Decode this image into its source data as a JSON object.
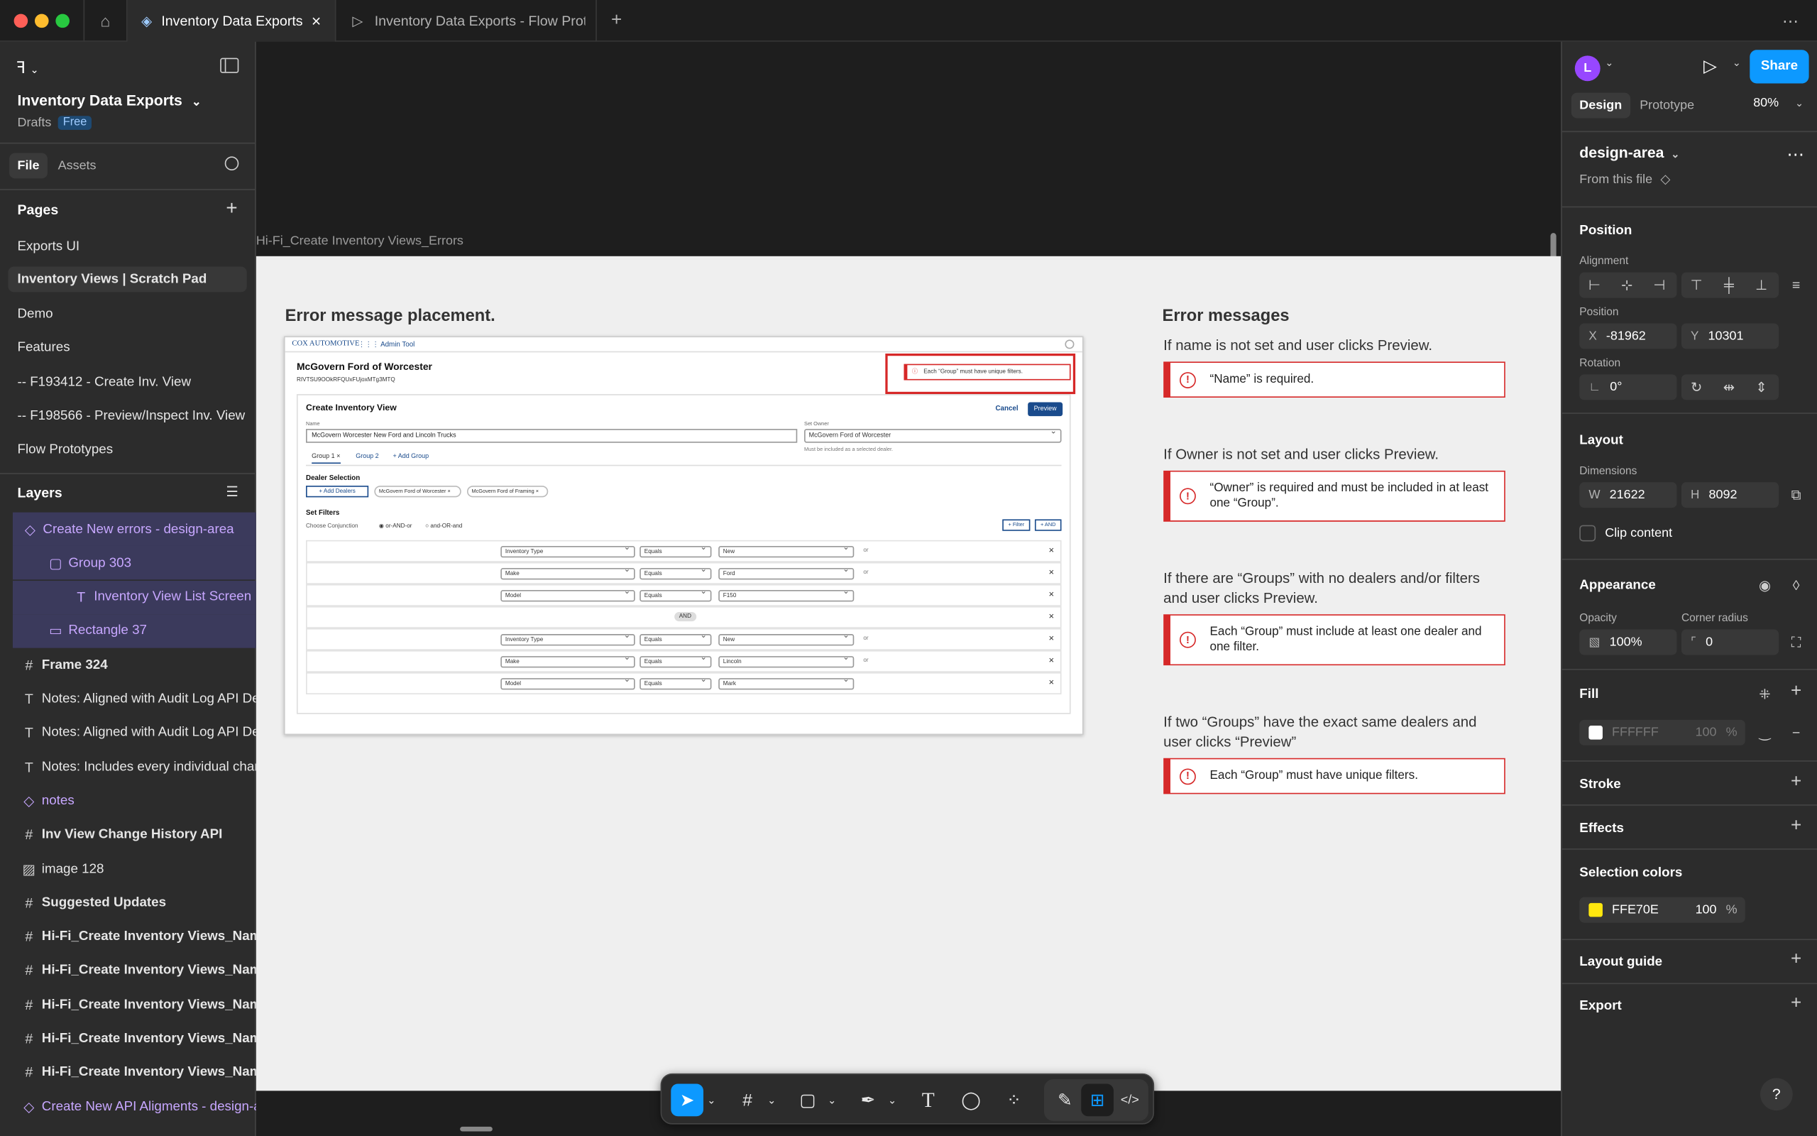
{
  "tabs": [
    {
      "label": "Inventory Data Exports",
      "active": true
    },
    {
      "label": "Inventory Data Exports - Flow Prototy",
      "active": false
    }
  ],
  "file": {
    "name": "Inventory Data Exports",
    "location": "Drafts",
    "plan": "Free"
  },
  "left_tabs": {
    "file": "File",
    "assets": "Assets"
  },
  "pages": {
    "title": "Pages",
    "items": [
      {
        "label": "Exports UI",
        "selected": false
      },
      {
        "label": "Inventory Views | Scratch Pad",
        "selected": true
      },
      {
        "label": "Demo",
        "selected": false
      },
      {
        "label": "Features",
        "selected": false
      },
      {
        "label": "-- F193412 - Create Inv. View",
        "selected": false
      },
      {
        "label": "-- F198566 - Preview/Inspect Inv. View",
        "selected": false
      },
      {
        "label": "Flow Prototypes",
        "selected": false
      }
    ]
  },
  "layers": {
    "title": "Layers",
    "items": [
      {
        "label": "Create New errors - design-area",
        "icon": "component-icon",
        "indent": 0,
        "selected": true,
        "purple": true
      },
      {
        "label": "Group 303",
        "icon": "group-icon",
        "indent": 1,
        "selected": true,
        "purple": true
      },
      {
        "label": "Inventory View List Screen",
        "icon": "text-icon",
        "indent": 2,
        "selected": true,
        "purple": true
      },
      {
        "label": "Rectangle 37",
        "icon": "rectangle-icon",
        "indent": 1,
        "selected": true,
        "purple": true
      },
      {
        "label": "Frame 324",
        "icon": "frame-icon",
        "indent": 0,
        "bold": true
      },
      {
        "label": "Notes: Aligned with Audit Log API Dea",
        "icon": "text-icon",
        "indent": 0
      },
      {
        "label": "Notes: Aligned with Audit Log API Dea",
        "icon": "text-icon",
        "indent": 0
      },
      {
        "label": "Notes: Includes every individual chang",
        "icon": "text-icon",
        "indent": 0
      },
      {
        "label": "notes",
        "icon": "component-icon",
        "indent": 0,
        "purple": true
      },
      {
        "label": "Inv View Change History API",
        "icon": "frame-icon",
        "indent": 0,
        "bold": true
      },
      {
        "label": "image 128",
        "icon": "image-icon",
        "indent": 0
      },
      {
        "label": "Suggested Updates",
        "icon": "frame-icon",
        "indent": 0,
        "bold": true
      },
      {
        "label": "Hi-Fi_Create Inventory Views_Name",
        "icon": "frame-icon",
        "indent": 0,
        "bold": true
      },
      {
        "label": "Hi-Fi_Create Inventory Views_Name",
        "icon": "frame-icon",
        "indent": 0,
        "bold": true
      },
      {
        "label": "Hi-Fi_Create Inventory Views_Name",
        "icon": "frame-icon",
        "indent": 0,
        "bold": true
      },
      {
        "label": "Hi-Fi_Create Inventory Views_Name",
        "icon": "frame-icon",
        "indent": 0,
        "bold": true
      },
      {
        "label": "Hi-Fi_Create Inventory Views_Name",
        "icon": "frame-icon",
        "indent": 0,
        "bold": true
      },
      {
        "label": "Create New API Aligments - design-ar",
        "icon": "component-icon",
        "indent": 0,
        "purple": true
      }
    ]
  },
  "canvas": {
    "frame_label": "Hi-Fi_Create Inventory Views_Errors",
    "placement_heading": "Error message placement.",
    "messages_heading": "Error messages",
    "conditions": [
      {
        "condition": "If name is not set and user clicks Preview.",
        "message": "“Name” is required."
      },
      {
        "condition": "If Owner is not set and user clicks Preview.",
        "message": "“Owner” is required and must be included in at least one “Group”."
      },
      {
        "condition": "If there are “Groups” with no dealers and/or filters and user clicks Preview.",
        "message": "Each “Group” must include at least one dealer and one filter."
      },
      {
        "condition": "If two “Groups” have the exact same dealers and user clicks “Preview”",
        "message": "Each “Group” must have unique filters."
      }
    ],
    "mock": {
      "brand": "COX AUTOMOTIVE",
      "tool": "Admin Tool",
      "dealer": "McGovern Ford of Worcester",
      "dealer_id": "RIVTSU9OOkRFQUxFUjoxMTg3MTQ",
      "error": "Each “Group” must have unique filters.",
      "page_title": "Create Inventory View",
      "cancel": "Cancel",
      "preview": "Preview",
      "name_label": "Name",
      "name_value": "McGovern Worcester New Ford and Lincoln Trucks",
      "owner_label": "Set Owner",
      "owner_value": "McGovern Ford of Worcester",
      "owner_hint": "Must be included as a selected dealer.",
      "group1": "Group 1",
      "group2": "Group 2",
      "add_group": "+ Add Group",
      "dealer_selection": "Dealer Selection",
      "add_dealers": "+ Add Dealers",
      "chip1": "McGovern Ford of Worcester",
      "chip2": "McGovern Ford of Framing",
      "set_filters": "Set Filters",
      "conjunction": "Choose Conjunction",
      "opt1": "or-AND-or",
      "opt2": "and-OR-and",
      "filter_btn": "+ Filter",
      "and_btn": "+ AND",
      "and_divider": "AND",
      "rows": [
        {
          "field": "Inventory Type",
          "op": "Equals",
          "value": "New",
          "conj": "or"
        },
        {
          "field": "Make",
          "op": "Equals",
          "value": "Ford",
          "conj": "or"
        },
        {
          "field": "Model",
          "op": "Equals",
          "value": "F150",
          "conj": ""
        },
        {
          "field": "Inventory Type",
          "op": "Equals",
          "value": "New",
          "conj": "or"
        },
        {
          "field": "Make",
          "op": "Equals",
          "value": "Lincoln",
          "conj": "or"
        },
        {
          "field": "Model",
          "op": "Equals",
          "value": "Mark",
          "conj": ""
        }
      ]
    }
  },
  "right": {
    "avatar": "L",
    "share": "Share",
    "tab_design": "Design",
    "tab_prototype": "Prototype",
    "zoom": "80%",
    "component_name": "design-area",
    "from_file": "From this file",
    "position_title": "Position",
    "alignment_label": "Alignment",
    "position_label": "Position",
    "x": "-81962",
    "y": "10301",
    "rotation_label": "Rotation",
    "rotation": "0°",
    "layout_title": "Layout",
    "dimensions_label": "Dimensions",
    "w": "21622",
    "h": "8092",
    "clip_content": "Clip content",
    "appearance_title": "Appearance",
    "opacity_label": "Opacity",
    "opacity": "100%",
    "radius_label": "Corner radius",
    "radius": "0",
    "fill_title": "Fill",
    "fill_hex": "FFFFFF",
    "fill_opacity": "100",
    "fill_color": "#ffffff",
    "stroke_title": "Stroke",
    "effects_title": "Effects",
    "selection_colors_title": "Selection colors",
    "sel_hex": "FFE70E",
    "sel_opacity": "100",
    "sel_color": "#ffe70e",
    "layout_guide_title": "Layout guide",
    "export_title": "Export",
    "percent": "%"
  },
  "axis_keys": {
    "x": "X",
    "y": "Y",
    "w": "W",
    "h": "H"
  },
  "colors": {
    "accent": "#0d99ff",
    "error": "#d62828",
    "component_purple": "#c7a7ff"
  }
}
